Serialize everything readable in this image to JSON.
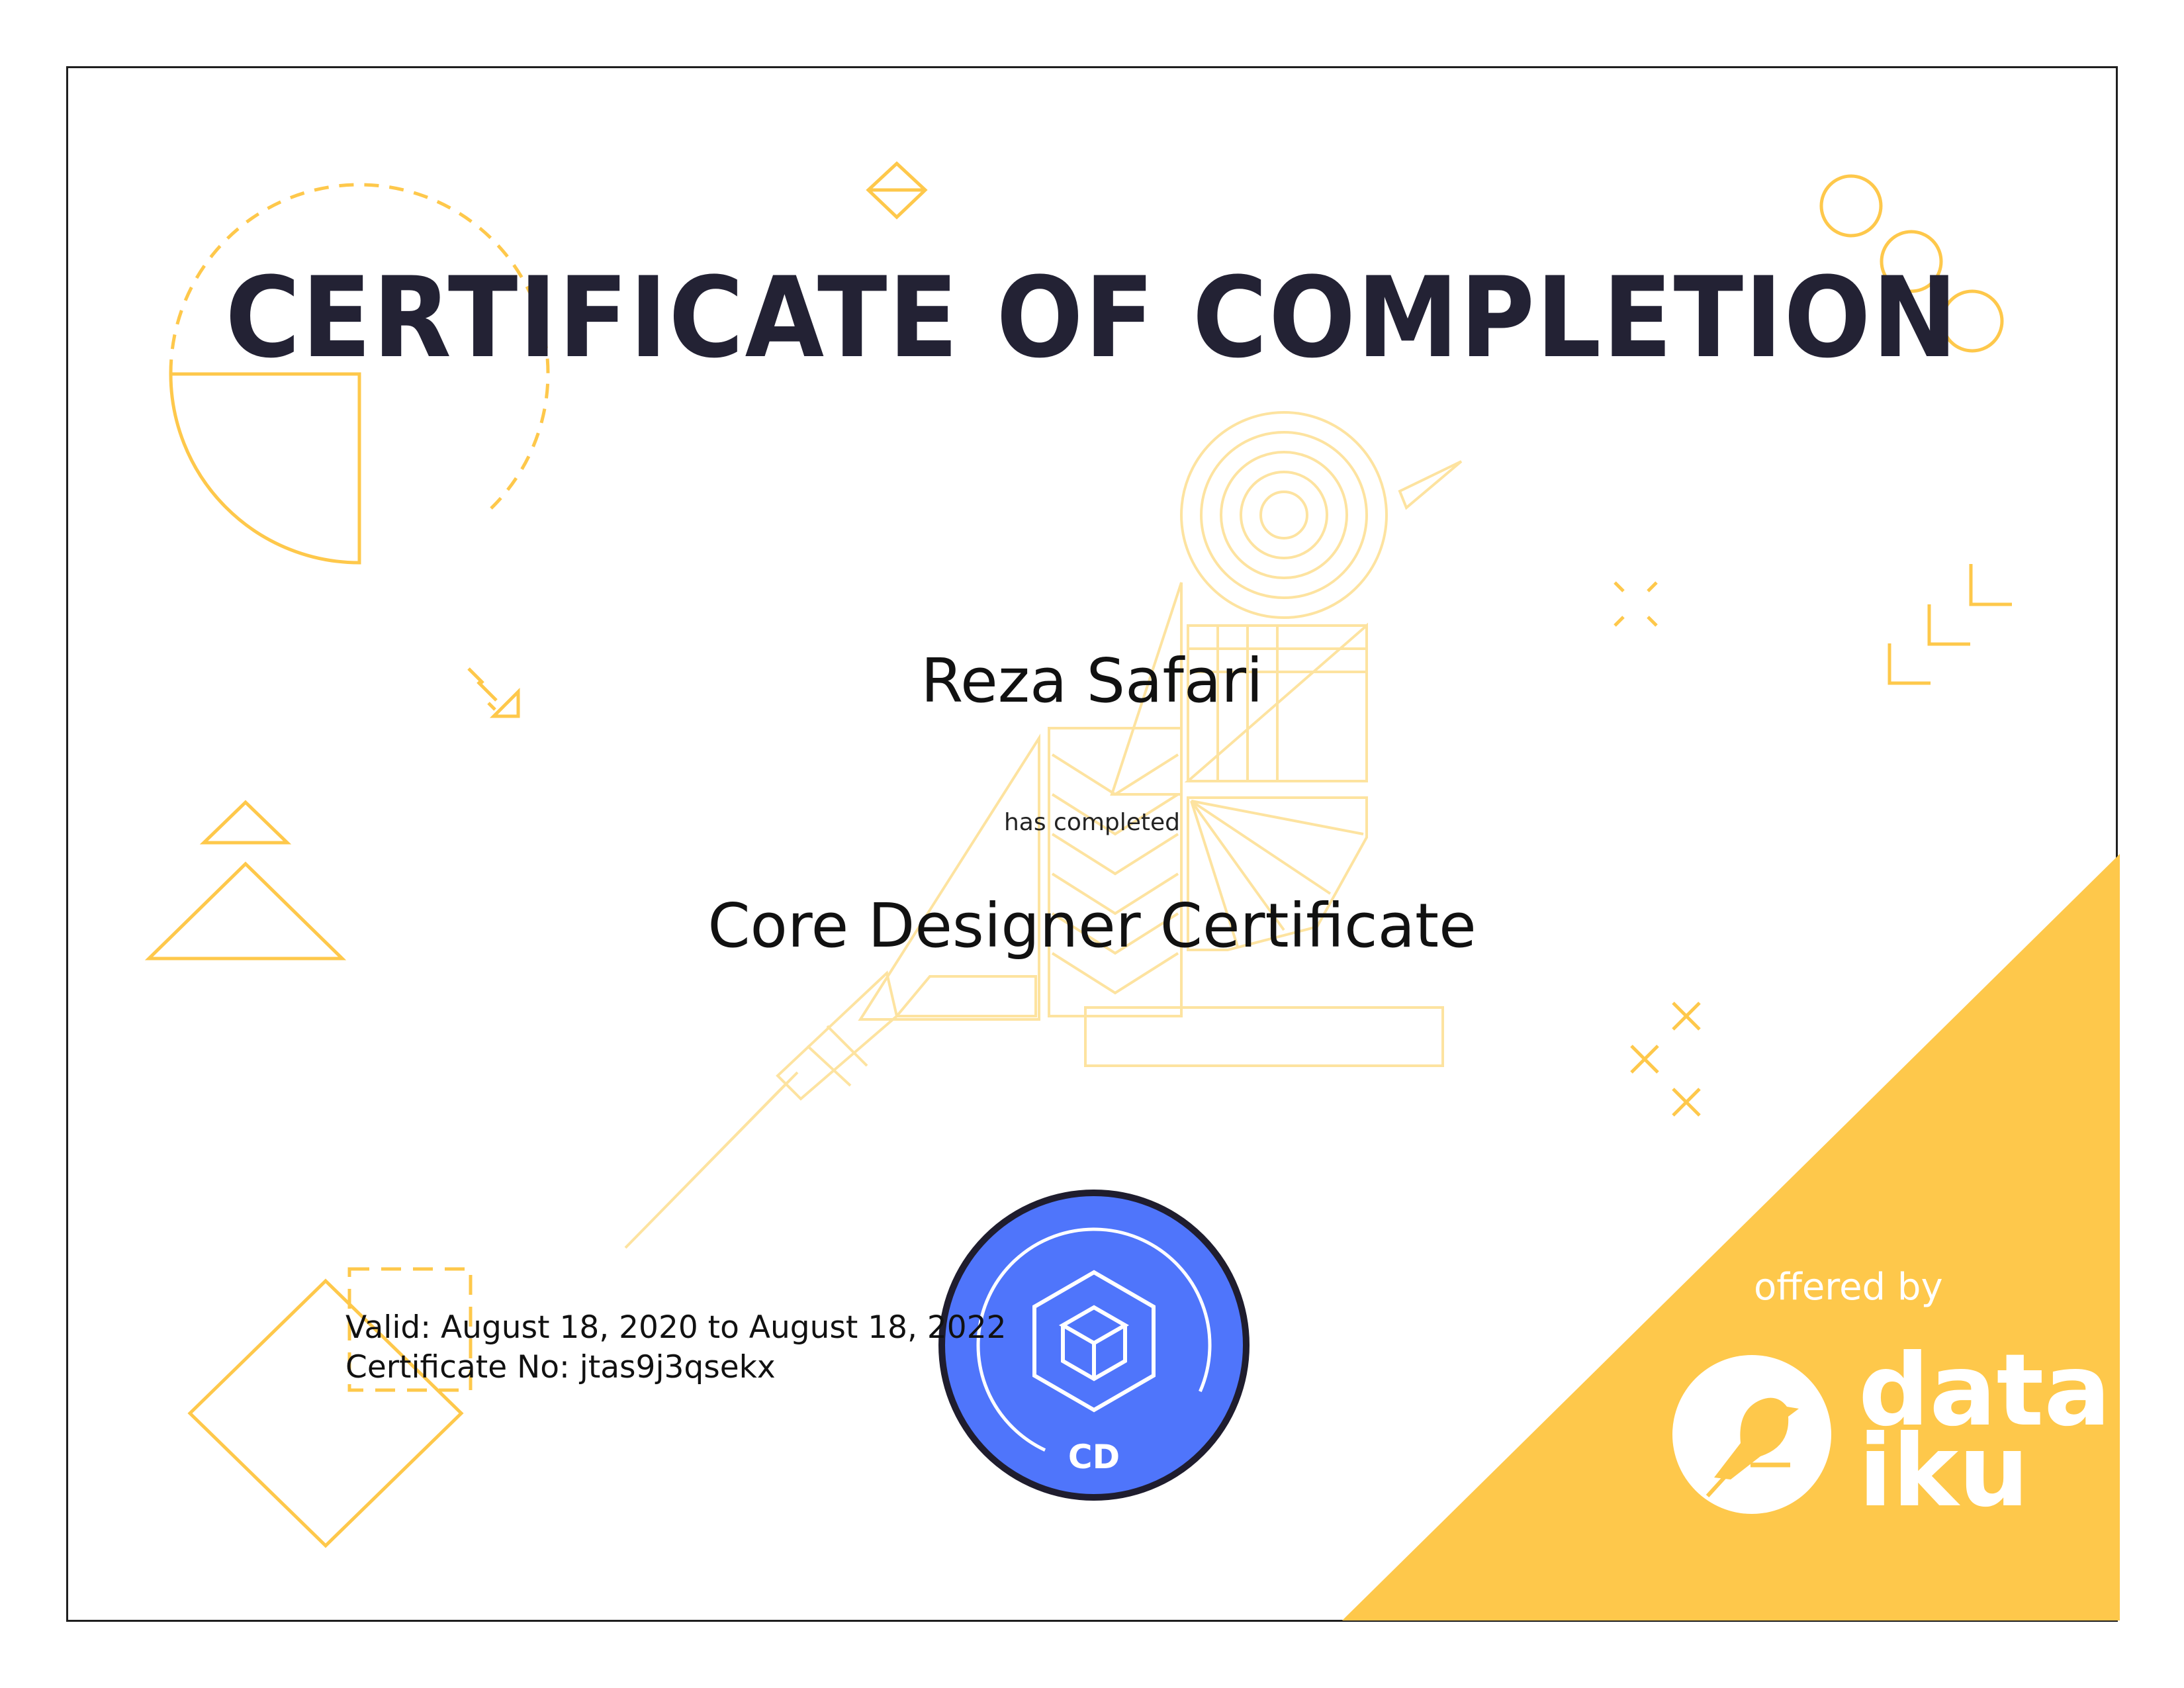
{
  "certificate": {
    "title": "CERTIFICATE OF COMPLETION",
    "recipient": "Reza Safari",
    "completed_text": "has completed",
    "course": "Core Designer Certificate",
    "valid_text": "Valid: August 18, 2020 to August 18, 2022",
    "certificate_no_text": "Certificate No: jtas9j3qsekx"
  },
  "badge": {
    "abbreviation": "CD"
  },
  "issuer": {
    "offered_by": "offered by",
    "brand_name": "data\niku"
  },
  "colors": {
    "accent_yellow": "#fec84b",
    "badge_blue": "#4f75fb",
    "title_navy": "#232234"
  },
  "icons": [
    "bird-line-art-icon",
    "cube-icon",
    "bird-logo-icon",
    "geometric-decorations"
  ]
}
